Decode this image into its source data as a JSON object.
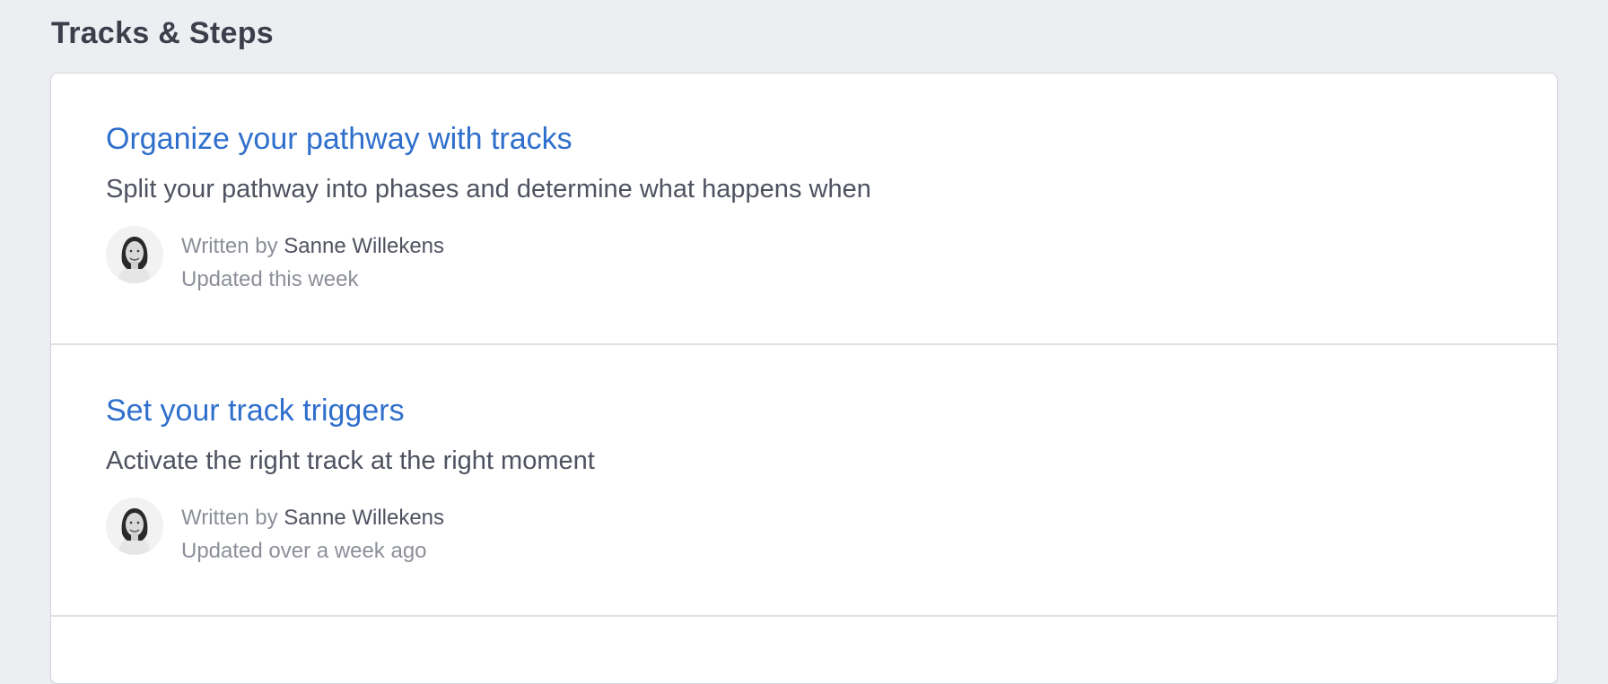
{
  "section": {
    "title": "Tracks & Steps"
  },
  "articles": [
    {
      "title": "Organize your pathway with tracks",
      "description": "Split your pathway into phases and determine what happens when",
      "written_by_label": "Written by",
      "author": "Sanne Willekens",
      "updated": "Updated this week"
    },
    {
      "title": "Set your track triggers",
      "description": "Activate the right track at the right moment",
      "written_by_label": "Written by",
      "author": "Sanne Willekens",
      "updated": "Updated over a week ago"
    }
  ],
  "colors": {
    "background": "#edeef2",
    "link": "#2f6fcc",
    "text": "#4f5260",
    "muted": "#8c8f99"
  }
}
